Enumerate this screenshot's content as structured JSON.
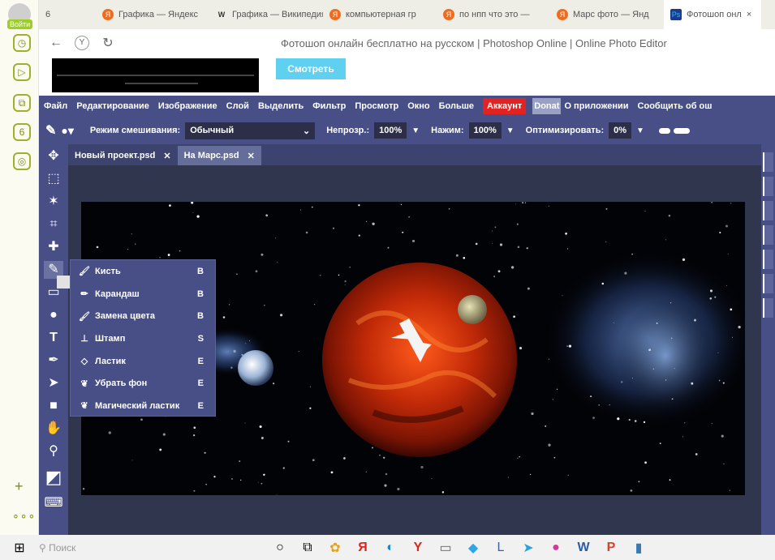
{
  "yandex_sidebar": {
    "login_label": "Войти",
    "items": [
      {
        "icon": "clock-icon",
        "glyph": "◷"
      },
      {
        "icon": "play-icon",
        "glyph": "▷"
      },
      {
        "icon": "copy-icon",
        "glyph": "⧉"
      },
      {
        "icon": "counter-icon",
        "glyph": "6"
      },
      {
        "icon": "privacy-icon",
        "glyph": "◎"
      }
    ],
    "add_glyph": "+",
    "more_glyph": "∘∘∘"
  },
  "browser_tabs": [
    {
      "label": "6",
      "favicon": ""
    },
    {
      "label": "Графика — Яндекс",
      "favicon": "Я"
    },
    {
      "label": "Графика — Википедия",
      "favicon": "W"
    },
    {
      "label": "компьютерная гр",
      "favicon": "Я"
    },
    {
      "label": "по нпп что это —",
      "favicon": "Я"
    },
    {
      "label": "Марс фото — Янд",
      "favicon": "Я"
    },
    {
      "label": "Фотошоп онл",
      "favicon": "Ps"
    }
  ],
  "tab_close_glyph": "×",
  "address_bar": {
    "back": "←",
    "refresh": "↻",
    "page_title": "Фотошоп онлайн бесплатно на русском | Photoshop Online | Online Photo Editor"
  },
  "ad": {
    "watch_button": "Смотреть"
  },
  "menu": [
    "Файл",
    "Редактирование",
    "Изображение",
    "Слой",
    "Выделить",
    "Фильтр",
    "Просмотр",
    "Окно",
    "Больше"
  ],
  "account_button": "Аккаунт",
  "donate_button": "Donat",
  "menu_extra": [
    "О приложении",
    "Сообщить об ош"
  ],
  "options_bar": {
    "blend_mode_label": "Режим смешивания:",
    "blend_mode_value": "Обычный",
    "opacity_label": "Непрозр.:",
    "opacity_value": "100%",
    "pressure_label": "Нажим:",
    "pressure_value": "100%",
    "optimize_label": "Оптимизировать:",
    "optimize_value": "0%",
    "dropdown_glyph": "▼"
  },
  "doc_tabs": [
    {
      "label": "Новый проект.psd",
      "active": false
    },
    {
      "label": "На Марс.psd",
      "active": true
    }
  ],
  "doc_tab_close_glyph": "✕",
  "tools": [
    {
      "icon": "move-tool-icon",
      "glyph": "✥"
    },
    {
      "icon": "marquee-tool-icon",
      "glyph": "⬚"
    },
    {
      "icon": "magic-wand-tool-icon",
      "glyph": "✶"
    },
    {
      "icon": "crop-tool-icon",
      "glyph": "⌗"
    },
    {
      "icon": "healing-tool-icon",
      "glyph": "✚"
    },
    {
      "icon": "brush-tool-icon",
      "glyph": "✎"
    },
    {
      "icon": "rectangle-tool-icon",
      "glyph": "▭"
    },
    {
      "icon": "blur-tool-icon",
      "glyph": "●"
    },
    {
      "icon": "text-tool-icon",
      "glyph": "T"
    },
    {
      "icon": "pen-tool-icon",
      "glyph": "✒"
    },
    {
      "icon": "path-select-tool-icon",
      "glyph": "➤"
    },
    {
      "icon": "shape-tool-icon",
      "glyph": "■"
    },
    {
      "icon": "hand-tool-icon",
      "glyph": "✋"
    },
    {
      "icon": "zoom-tool-icon",
      "glyph": "⚲"
    },
    {
      "icon": "color-swatch-icon",
      "glyph": "◩"
    },
    {
      "icon": "keyboard-icon",
      "glyph": "⌨"
    }
  ],
  "brush_flyout": [
    {
      "label": "Кисть",
      "key": "B",
      "icon": "brush-icon",
      "glyph": "🖌"
    },
    {
      "label": "Карандаш",
      "key": "B",
      "icon": "pencil-icon",
      "glyph": "✏"
    },
    {
      "label": "Замена цвета",
      "key": "B",
      "icon": "color-replace-icon",
      "glyph": "🖌"
    },
    {
      "label": "Штамп",
      "key": "S",
      "icon": "stamp-icon",
      "glyph": "⊥"
    },
    {
      "label": "Ластик",
      "key": "E",
      "icon": "eraser-icon",
      "glyph": "◇"
    },
    {
      "label": "Убрать фон",
      "key": "E",
      "icon": "background-eraser-icon",
      "glyph": "❦"
    },
    {
      "label": "Магический ластик",
      "key": "E",
      "icon": "magic-eraser-icon",
      "glyph": "❦"
    }
  ],
  "taskbar": {
    "search_placeholder": "Поиск",
    "items": [
      {
        "icon": "cortana-icon",
        "glyph": "○",
        "color": "#111111"
      },
      {
        "icon": "task-view-icon",
        "glyph": "⧉",
        "color": "#333333"
      },
      {
        "icon": "pinwheel-app-icon",
        "glyph": "✿",
        "color": "#e8a11a"
      },
      {
        "icon": "yandex-app-icon",
        "glyph": "Я",
        "color": "#e0231b"
      },
      {
        "icon": "edge-icon",
        "glyph": "◐",
        "color": "#1a88d4"
      },
      {
        "icon": "yandex-browser-icon",
        "glyph": "Y",
        "color": "#e0231b"
      },
      {
        "icon": "store-icon",
        "glyph": "▭",
        "color": "#666666"
      },
      {
        "icon": "3d-app-icon",
        "glyph": "◆",
        "color": "#2ea6e8"
      },
      {
        "icon": "paint-icon",
        "glyph": "L",
        "color": "#3a62b0"
      },
      {
        "icon": "telegram-icon",
        "glyph": "➤",
        "color": "#29a3dc"
      },
      {
        "icon": "paint3d-icon",
        "glyph": "●",
        "color": "#d03a9a"
      },
      {
        "icon": "word-icon",
        "glyph": "W",
        "color": "#2b5ca8"
      },
      {
        "icon": "powerpoint-icon",
        "glyph": "P",
        "color": "#d2472c"
      },
      {
        "icon": "app-icon",
        "glyph": "▮",
        "color": "#3a7ab0"
      }
    ]
  },
  "colors": {
    "menu_bg": "#474f86",
    "canvas_bg": "#020307",
    "account_red": "#e32222",
    "watch_button": "#5fd0f0"
  }
}
